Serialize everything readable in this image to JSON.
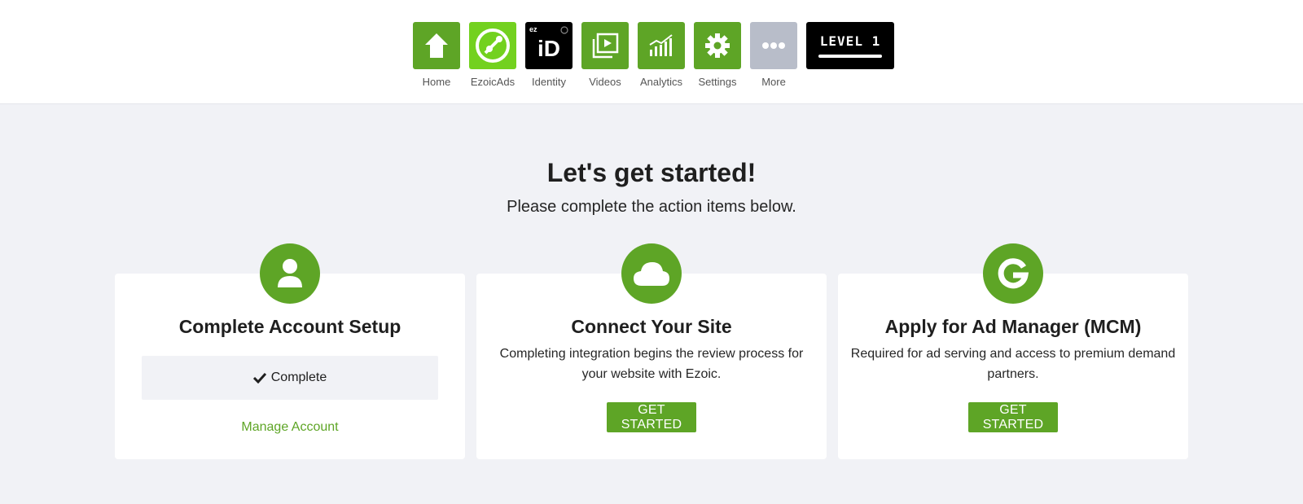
{
  "nav": {
    "items": [
      {
        "label": "Home",
        "icon": "home-icon",
        "color": "#5ea526"
      },
      {
        "label": "EzoicAds",
        "icon": "ezoicads-icon",
        "color": "#73d11f"
      },
      {
        "label": "Identity",
        "icon": "identity-icon",
        "color": "#000000",
        "tile_text": "iD",
        "tile_small": "ez"
      },
      {
        "label": "Videos",
        "icon": "video-icon",
        "color": "#5ea526"
      },
      {
        "label": "Analytics",
        "icon": "analytics-icon",
        "color": "#5ea526"
      },
      {
        "label": "Settings",
        "icon": "gear-icon",
        "color": "#5ea526"
      },
      {
        "label": "More",
        "icon": "more-icon",
        "color": "#b8bdc9"
      }
    ],
    "level": {
      "label": "LEVEL 1"
    }
  },
  "main": {
    "title": "Let's get started!",
    "subtitle": "Please complete the action items below."
  },
  "cards": [
    {
      "icon": "user-icon",
      "title": "Complete Account Setup",
      "status": "Complete",
      "link": "Manage Account"
    },
    {
      "icon": "cloud-icon",
      "title": "Connect Your Site",
      "description": "Completing integration begins the review process for your website with Ezoic.",
      "button": "GET STARTED"
    },
    {
      "icon": "google-icon",
      "title": "Apply for Ad Manager (MCM)",
      "description": "Required for ad serving and access to premium demand partners.",
      "button": "GET STARTED"
    }
  ],
  "colors": {
    "accent": "#5ea526",
    "background": "#f1f2f6"
  }
}
